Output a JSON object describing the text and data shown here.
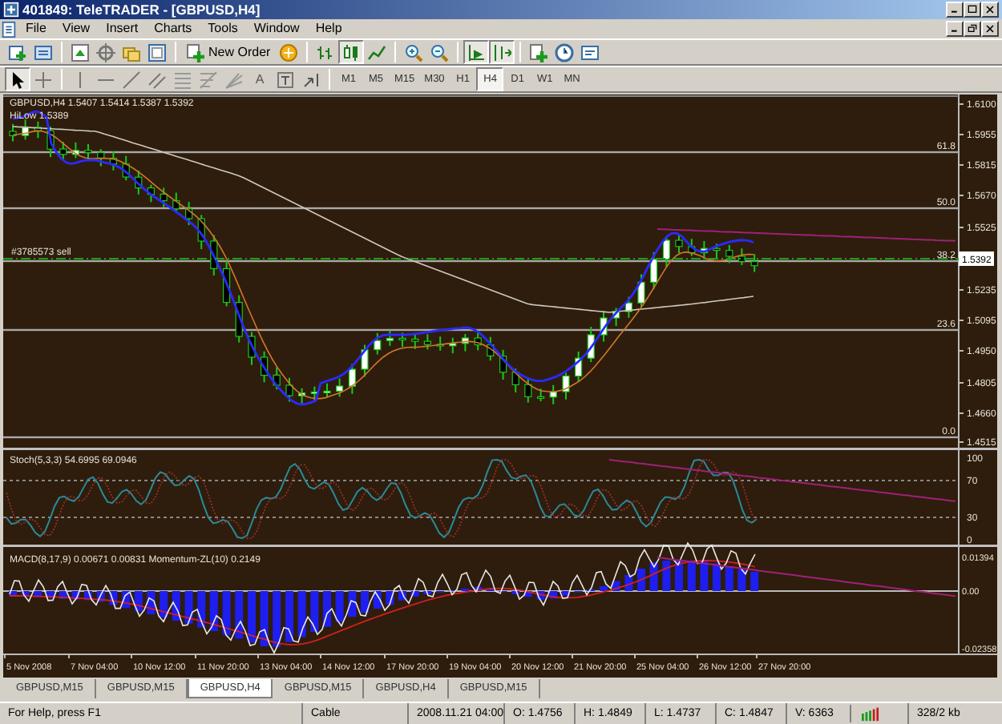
{
  "window": {
    "title": "401849: TeleTRADER - [GBPUSD,H4]"
  },
  "menu": [
    "File",
    "View",
    "Insert",
    "Charts",
    "Tools",
    "Window",
    "Help"
  ],
  "toolbar": {
    "new_order": "New Order",
    "text_tool": "A",
    "chart_types": [
      {
        "kind": "bar",
        "selected": false
      },
      {
        "kind": "candle",
        "selected": true
      },
      {
        "kind": "line",
        "selected": false
      }
    ],
    "autoscroll": {
      "on": true
    },
    "chart_shift": {
      "on": true
    }
  },
  "timeframes": [
    {
      "label": "M1",
      "selected": false
    },
    {
      "label": "M5",
      "selected": false
    },
    {
      "label": "M15",
      "selected": false
    },
    {
      "label": "M30",
      "selected": false
    },
    {
      "label": "H1",
      "selected": false
    },
    {
      "label": "H4",
      "selected": true
    },
    {
      "label": "D1",
      "selected": false
    },
    {
      "label": "W1",
      "selected": false
    },
    {
      "label": "MN",
      "selected": false
    }
  ],
  "chart": {
    "symbol_label": "GBPUSD,H4  1.5407 1.5414 1.5387 1.5392",
    "indicator_label": "HiLow 1.5389",
    "order_label": "#3785573 sell",
    "price_ticks": [
      "1.6100",
      "1.5955",
      "1.5815",
      "1.5670",
      "1.5525",
      "1.5235",
      "1.5095",
      "1.4950",
      "1.4805",
      "1.4660",
      "1.4515"
    ],
    "current_price": "1.5392",
    "fib_levels": [
      "61.8",
      "50.0",
      "38.2",
      "23.6",
      "0.0"
    ],
    "stoch": {
      "label": "Stoch(5,3,3) 54.6995 69.0946",
      "ticks": [
        "100",
        "70",
        "30",
        "0"
      ]
    },
    "macd": {
      "label": "MACD(8,17,9) 0.00671 0.00831  Momentum-ZL(10) 0.2149",
      "ticks": [
        "0.01394",
        "0.00",
        "-0.02358"
      ]
    },
    "time_labels": [
      "5 Nov 2008",
      "7 Nov 04:00",
      "10 Nov 12:00",
      "11 Nov 20:00",
      "13 Nov 04:00",
      "14 Nov 12:00",
      "17 Nov 20:00",
      "19 Nov 04:00",
      "20 Nov 12:00",
      "21 Nov 20:00",
      "25 Nov 04:00",
      "26 Nov 12:00",
      "27 Nov 20:00"
    ]
  },
  "tabs": [
    {
      "label": "GBPUSD,M15",
      "selected": false
    },
    {
      "label": "GBPUSD,M15",
      "selected": false
    },
    {
      "label": "GBPUSD,H4",
      "selected": true
    },
    {
      "label": "GBPUSD,M15",
      "selected": false
    },
    {
      "label": "GBPUSD,H4",
      "selected": false
    },
    {
      "label": "GBPUSD,M15",
      "selected": false
    }
  ],
  "status_bar": [
    "For Help, press F1",
    "Cable",
    "2008.11.21 04:00",
    "O: 1.4756",
    "H: 1.4849",
    "L: 1.4737",
    "C: 1.4847",
    "V: 6363",
    "328/2 kb"
  ]
}
